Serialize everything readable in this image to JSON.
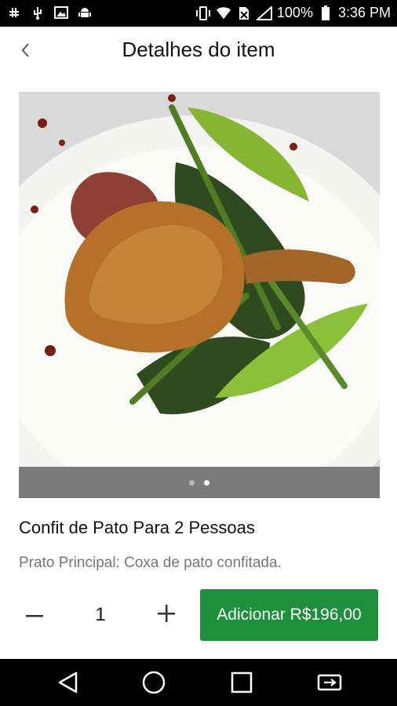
{
  "status_bar": {
    "battery": "100%",
    "time": "3:36 PM",
    "icons": [
      "slack-icon",
      "usb-icon",
      "image-icon",
      "android-icon",
      "vibrate-icon",
      "wifi-icon",
      "no-sim-icon",
      "signal-icon",
      "battery-icon"
    ]
  },
  "header": {
    "title": "Detalhes do item",
    "back_icon": "chevron-left-icon"
  },
  "image": {
    "description_icon": "food-photo",
    "pager": {
      "count": 2,
      "active_index": 1
    }
  },
  "item": {
    "name": "Confit de Pato Para 2 Pessoas",
    "description": "Prato Principal: Coxa de pato confitada."
  },
  "order": {
    "quantity": "1",
    "add_label": "Adicionar R$196,00",
    "accent_color": "#1e8f3a"
  },
  "nav_bar": {
    "icons": [
      "back-triangle-icon",
      "home-circle-icon",
      "recents-square-icon",
      "screen-rotate-icon"
    ]
  }
}
